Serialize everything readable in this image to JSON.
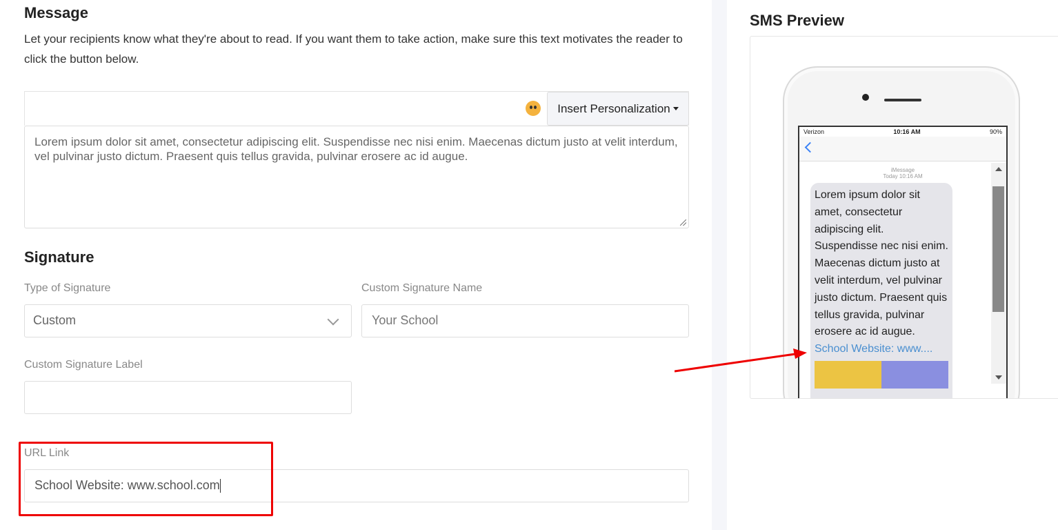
{
  "message": {
    "title": "Message",
    "description": "Let your recipients know what they're about to read. If you want them to take action, make sure this text motivates the reader to click the button below.",
    "insert_personalization": "Insert Personalization",
    "body": "Lorem ipsum dolor sit amet, consectetur adipiscing elit. Suspendisse nec nisi enim. Maecenas dictum justo at velit interdum, vel pulvinar justo dictum. Praesent quis tellus gravida, pulvinar erosere ac id augue."
  },
  "signature": {
    "title": "Signature",
    "type_label": "Type of Signature",
    "type_value": "Custom",
    "name_label": "Custom Signature Name",
    "name_placeholder": "Your School",
    "sig_label": "Custom Signature Label",
    "sig_value": "",
    "url_label": "URL Link",
    "url_value": "School Website: www.school.com"
  },
  "preview": {
    "title": "SMS Preview",
    "carrier": "Verizon",
    "time": "10:16 AM",
    "battery": "90%",
    "imessage": "iMessage",
    "timestamp": "Today 10:16 AM",
    "bubble_text": "Lorem ipsum dolor sit amet, consectetur adipiscing elit. Suspendisse nec nisi enim. Maecenas dictum justo at velit interdum, vel pulvinar justo dictum. Praesent quis tellus gravida, pulvinar erosere ac id augue.",
    "bubble_link": "School Website: www...."
  },
  "colors": {
    "annotation": "#ee0000",
    "link": "#4a8fd0",
    "bubble": "#e5e5ea"
  }
}
